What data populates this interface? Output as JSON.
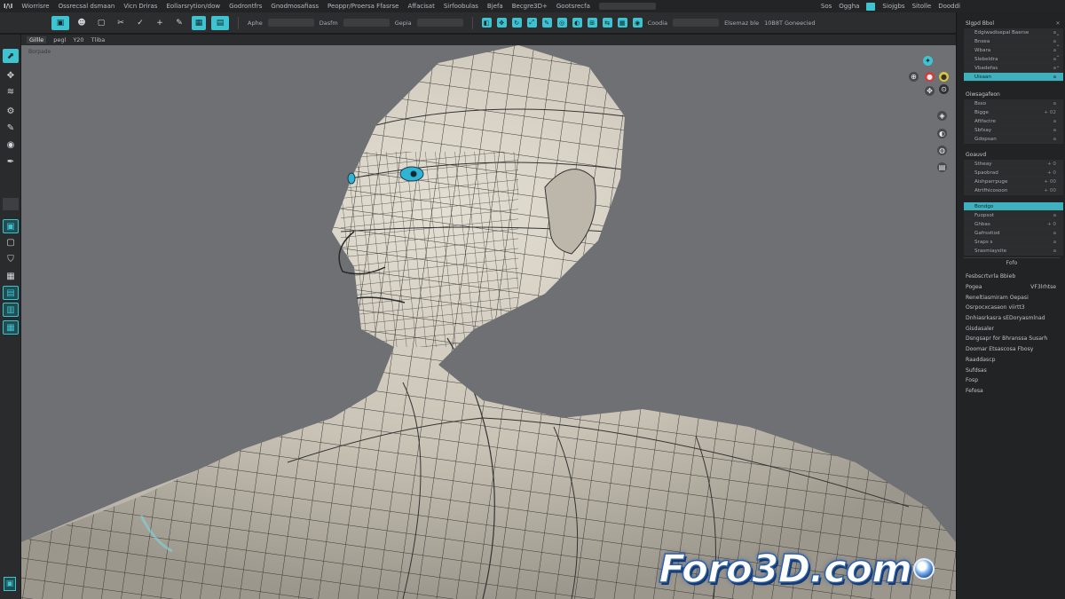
{
  "menubar": {
    "logo": "I/\\I",
    "items": [
      "Wiorrisre",
      "Ossrecsal dsmaan",
      "Vicn Driras",
      "Eollarsrytion/dow",
      "Godrontfrs",
      "Gnodmosafiass",
      "Peoppr/Proersa Ffasrse",
      "Affacisat",
      "Sirfoobulas",
      "Bjefa",
      "Becgre3D+",
      "Gootsrecfa"
    ],
    "right_items": [
      "Sos",
      "Oggha",
      "Siojgbs",
      "Sitolle",
      "Dooddi"
    ]
  },
  "toolbar": {
    "labels": [
      "Aphe",
      "Dasfm",
      "Gepia",
      "Coodia",
      "Elsemaz ble",
      "10B8T Goneecied"
    ]
  },
  "subtool": {
    "items": [
      "Gillle",
      "pegl",
      "Y20",
      "Tliba"
    ]
  },
  "viewport": {
    "label": "Borpade",
    "watermark": "Foro3D.com"
  },
  "rightpanel": {
    "section1": {
      "title": "Slgpd Bbol",
      "rows": [
        {
          "label": "Edgiwadisepal Baerse",
          "value": "a"
        },
        {
          "label": "Bnsea",
          "value": "a"
        },
        {
          "label": "Wbara",
          "value": "a"
        },
        {
          "label": "Slebeldra",
          "value": "a"
        },
        {
          "label": "Vbadefas",
          "value": "a"
        },
        {
          "label": "Uisaan",
          "value": "a",
          "selected": true
        }
      ]
    },
    "section2": {
      "title": "Oiwsagafeon",
      "rows": [
        {
          "label": "Bsso",
          "value": "a"
        },
        {
          "label": "Bigge",
          "value": "+ 02"
        },
        {
          "label": "Aftfactre",
          "value": "a"
        },
        {
          "label": "Sbfxay",
          "value": "a"
        },
        {
          "label": "Gdopsan",
          "value": "a"
        }
      ]
    },
    "section3": {
      "title": "Goauvd",
      "rows": [
        {
          "label": "Stheay",
          "value": "+ 0"
        },
        {
          "label": "Spaobrad",
          "value": "+ 0"
        },
        {
          "label": "Aishparrpuge",
          "value": "+ 00"
        },
        {
          "label": "Atrtfhicosoon",
          "value": "+ 00"
        }
      ]
    },
    "section4": {
      "rows": [
        {
          "label": "Bondgo",
          "value": "",
          "selected": true
        },
        {
          "label": "Fuopsot",
          "value": "a"
        },
        {
          "label": "Ghbas",
          "value": "+ 0"
        },
        {
          "label": "Gafrsstiod",
          "value": "a"
        },
        {
          "label": "Sraps s",
          "value": "a"
        },
        {
          "label": "Srasmiaysite",
          "value": "a"
        }
      ]
    },
    "button": "Fofo",
    "list": [
      {
        "label": "Fesbscrtvrla Bbieb",
        "value": ""
      },
      {
        "label": "Pogea",
        "value": "VF3lrhtse"
      },
      {
        "label": "Reneltiasmiram Oepasi",
        "value": ""
      },
      {
        "label": "Osrpocxcasaon viirtt3",
        "value": ""
      },
      {
        "label": "Dnhiasrkasra sEDoryasmlnad",
        "value": ""
      },
      {
        "label": "Gisdasaler",
        "value": ""
      },
      {
        "label": "Dsngsapr for Bhranssa Susarh",
        "value": ""
      },
      {
        "label": "Doomar Etsascosa Fbosy",
        "value": ""
      },
      {
        "label": "Raaddascp",
        "value": ""
      },
      {
        "label": "Sufdsas",
        "value": ""
      },
      {
        "label": "Fosp",
        "value": ""
      },
      {
        "label": "Fefesa",
        "value": ""
      }
    ]
  },
  "colors": {
    "accent": "#3fc3d1",
    "viewport_bg": "#6e7073",
    "mesh_skin": "#cfc9bc",
    "eye": "#2fb4d6"
  }
}
